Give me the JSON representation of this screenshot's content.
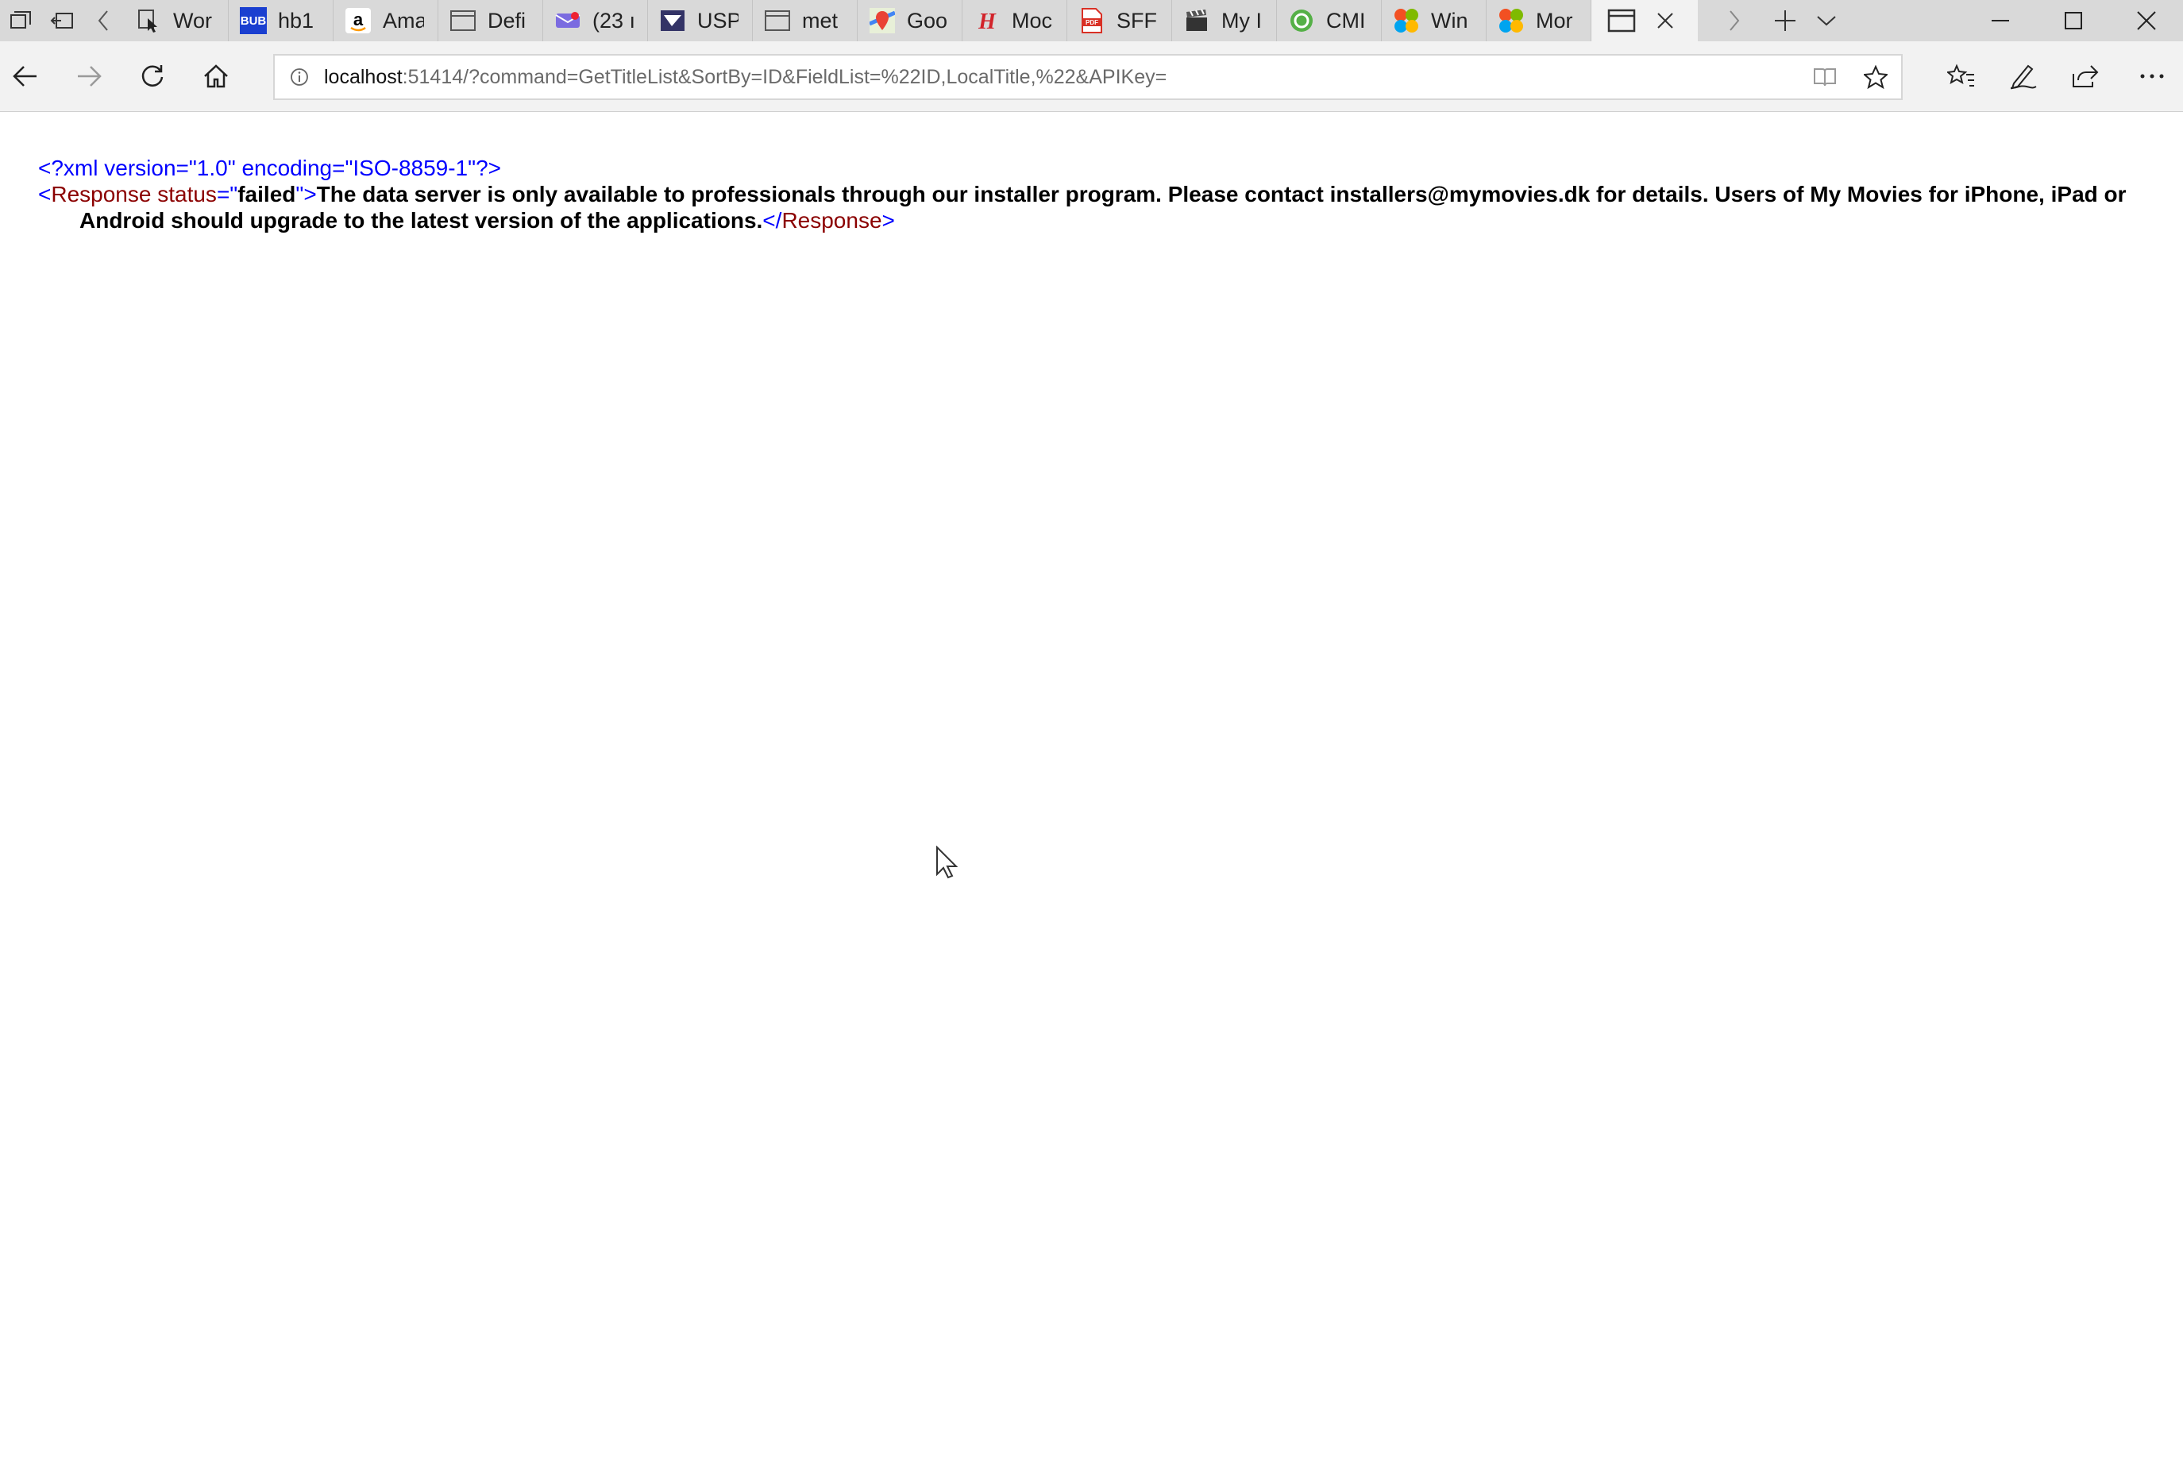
{
  "tabs": [
    {
      "title": "Wor",
      "favicon": "doc-cursor-icon",
      "color": "#3a3a3a"
    },
    {
      "title": "hb1",
      "favicon": "bub-icon",
      "color": "#1a3fd0"
    },
    {
      "title": "Ama",
      "favicon": "amazon-icon",
      "color": "#000000"
    },
    {
      "title": "Defi",
      "favicon": "page-icon",
      "color": "#555555"
    },
    {
      "title": "(23 ı",
      "favicon": "mail-icon",
      "color": "#6b5bd6"
    },
    {
      "title": "USP",
      "favicon": "usps-icon",
      "color": "#333366"
    },
    {
      "title": "met",
      "favicon": "page-icon",
      "color": "#555555"
    },
    {
      "title": "Goo",
      "favicon": "maps-icon",
      "color": "#34a853"
    },
    {
      "title": "Moc",
      "favicon": "h-icon",
      "color": "#d2232a"
    },
    {
      "title": "SFF-",
      "favicon": "pdf-icon",
      "color": "#d93025"
    },
    {
      "title": "My I",
      "favicon": "clapper-icon",
      "color": "#444444"
    },
    {
      "title": "CMI",
      "favicon": "cm-icon",
      "color": "#55b047"
    },
    {
      "title": "Win",
      "favicon": "windows-icon",
      "color": "#e8442c"
    },
    {
      "title": "Mor",
      "favicon": "windows-icon",
      "color": "#e8442c"
    }
  ],
  "address": {
    "host": "localhost",
    "rest": ":51414/?command=GetTitleList&SortBy=ID&FieldList=%22ID,LocalTitle,%22&APIKey="
  },
  "xml": {
    "declaration": "<?xml version=\"1.0\" encoding=\"ISO-8859-1\"?>",
    "open_bracket": "<",
    "tag_name": "Response",
    "attr_name": " status",
    "equals": "=\"",
    "attr_value": "failed",
    "close_quote_bracket": "\">",
    "message": "The data server is only available to professionals through our installer program. Please contact installers@mymovies.dk for details. Users of My Movies for iPhone, iPad or Android should upgrade to the latest version of the applications.",
    "end_open": "</",
    "end_tag_name": "Response",
    "end_close": ">"
  }
}
